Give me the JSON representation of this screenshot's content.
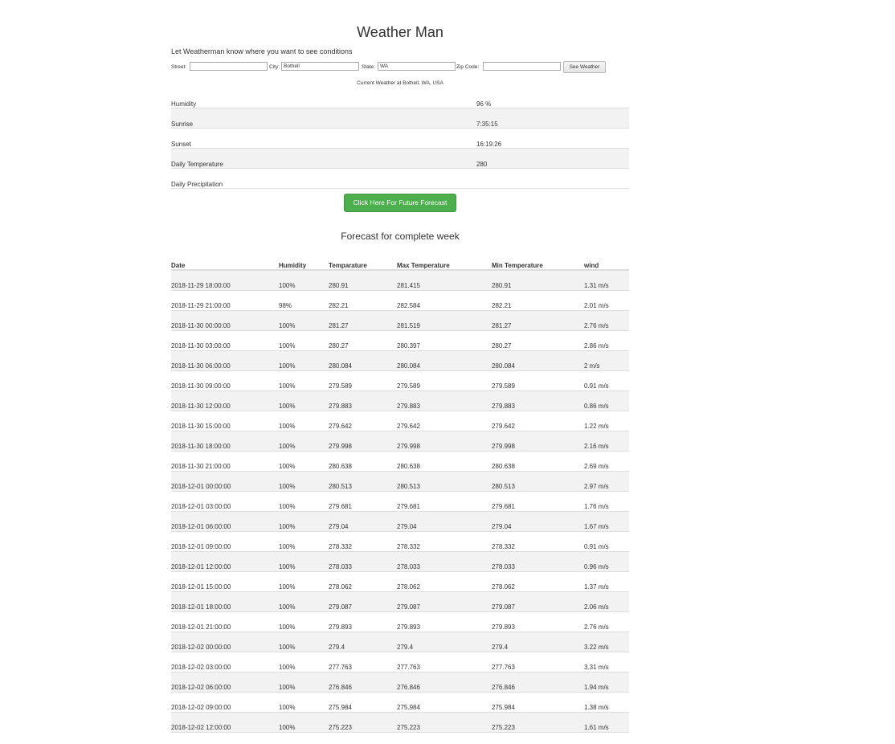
{
  "title": "Weather Man",
  "prompt": "Let Weatherman know where you want to see conditions",
  "form": {
    "street_label": "Street:",
    "street_value": "",
    "city_label": "City:",
    "city_value": "Bothell",
    "state_label": "State:",
    "state_value": "WA",
    "zip_label": "Zip Code:",
    "zip_value": "",
    "submit_label": "See Weather"
  },
  "current": {
    "caption": "Current Weather at Bothell, WA, USA",
    "rows": [
      {
        "label": "Humidity",
        "value": "96 %"
      },
      {
        "label": "Sunrise",
        "value": "7:35:15"
      },
      {
        "label": "Sunset",
        "value": "16:19:26"
      },
      {
        "label": "Daily Temperature",
        "value": "280"
      },
      {
        "label": "Daily Precipitation",
        "value": ""
      }
    ]
  },
  "forecast_button_label": "Click Here For Future Forecast",
  "week": {
    "title": "Forecast for complete week",
    "headers": [
      "Date",
      "Humidity",
      "Temparature",
      "Max Temperature",
      "Min Temperature",
      "wind"
    ],
    "rows": [
      [
        "2018-11-29 18:00:00",
        "100%",
        "280.91",
        "281.415",
        "280.91",
        "1.31 m/s"
      ],
      [
        "2018-11-29 21:00:00",
        "98%",
        "282.21",
        "282.584",
        "282.21",
        "2.01 m/s"
      ],
      [
        "2018-11-30 00:00:00",
        "100%",
        "281.27",
        "281.519",
        "281.27",
        "2.76 m/s"
      ],
      [
        "2018-11-30 03:00:00",
        "100%",
        "280.27",
        "280.397",
        "280.27",
        "2.86 m/s"
      ],
      [
        "2018-11-30 06:00:00",
        "100%",
        "280.084",
        "280.084",
        "280.084",
        "2 m/s"
      ],
      [
        "2018-11-30 09:00:00",
        "100%",
        "279.589",
        "279.589",
        "279.589",
        "0.91 m/s"
      ],
      [
        "2018-11-30 12:00:00",
        "100%",
        "279.883",
        "279.883",
        "279.883",
        "0.86 m/s"
      ],
      [
        "2018-11-30 15:00:00",
        "100%",
        "279.642",
        "279.642",
        "279.642",
        "1.22 m/s"
      ],
      [
        "2018-11-30 18:00:00",
        "100%",
        "279.998",
        "279.998",
        "279.998",
        "2.16 m/s"
      ],
      [
        "2018-11-30 21:00:00",
        "100%",
        "280.638",
        "280.638",
        "280.638",
        "2.69 m/s"
      ],
      [
        "2018-12-01 00:00:00",
        "100%",
        "280.513",
        "280.513",
        "280.513",
        "2.97 m/s"
      ],
      [
        "2018-12-01 03:00:00",
        "100%",
        "279.681",
        "279.681",
        "279.681",
        "1.76 m/s"
      ],
      [
        "2018-12-01 06:00:00",
        "100%",
        "279.04",
        "279.04",
        "279.04",
        "1.67 m/s"
      ],
      [
        "2018-12-01 09:00:00",
        "100%",
        "278.332",
        "278.332",
        "278.332",
        "0.91 m/s"
      ],
      [
        "2018-12-01 12:00:00",
        "100%",
        "278.033",
        "278.033",
        "278.033",
        "0.96 m/s"
      ],
      [
        "2018-12-01 15:00:00",
        "100%",
        "278.062",
        "278.062",
        "278.062",
        "1.37 m/s"
      ],
      [
        "2018-12-01 18:00:00",
        "100%",
        "279.087",
        "279.087",
        "279.087",
        "2.06 m/s"
      ],
      [
        "2018-12-01 21:00:00",
        "100%",
        "279.893",
        "279.893",
        "279.893",
        "2.76 m/s"
      ],
      [
        "2018-12-02 00:00:00",
        "100%",
        "279.4",
        "279.4",
        "279.4",
        "3.22 m/s"
      ],
      [
        "2018-12-02 03:00:00",
        "100%",
        "277.763",
        "277.763",
        "277.763",
        "3.31 m/s"
      ],
      [
        "2018-12-02 06:00:00",
        "100%",
        "276.846",
        "276.846",
        "276.846",
        "1.94 m/s"
      ],
      [
        "2018-12-02 09:00:00",
        "100%",
        "275.984",
        "275.984",
        "275.984",
        "1.38 m/s"
      ],
      [
        "2018-12-02 12:00:00",
        "100%",
        "275.223",
        "275.223",
        "275.223",
        "1.61 m/s"
      ]
    ]
  }
}
